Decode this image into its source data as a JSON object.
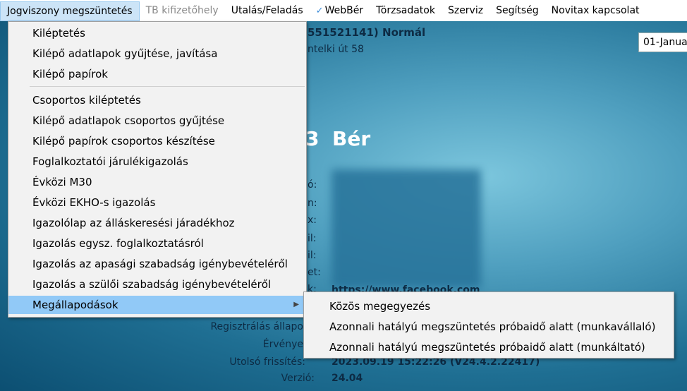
{
  "menubar": {
    "items": [
      {
        "label": "Jogviszony megszüntetés"
      },
      {
        "label": "TB kifizetőhely"
      },
      {
        "label": "Utalás/Feladás"
      },
      {
        "label": "WebBér"
      },
      {
        "label": "Törzsadatok"
      },
      {
        "label": "Szerviz"
      },
      {
        "label": "Segítség"
      },
      {
        "label": "Novitax kapcsolat"
      }
    ],
    "webber_check": "✓"
  },
  "dropdown": {
    "group1": [
      "Kiléptetés",
      "Kilépő adatlapok gyűjtése, javítása",
      "Kilépő papírok"
    ],
    "group2": [
      "Csoportos kiléptetés",
      "Kilépő adatlapok csoportos gyűjtése",
      "Kilépő papírok csoportos készítése",
      "Foglalkoztatói járulékigazolás",
      "Évközi M30",
      "Évközi EKHO-s igazolás",
      "Igazolólap az álláskeresési járadékhoz",
      "Igazolás egysz. foglalkoztatásról",
      "Igazolás az apasági szabadság igénybevételéről",
      "Igazolás a szülői szabadság igénybevételéről",
      "Megállapodások"
    ],
    "submenu_arrow": "▶"
  },
  "submenu": {
    "items": [
      "Közös megegyezés",
      "Azonnali hatályú megszüntetés próbaidő alatt (munkavállaló)",
      "Azonnali hatályú megszüntetés próbaidő alatt (munkáltató)"
    ]
  },
  "background": {
    "company_line": "551521141) Normál",
    "address_line": "ntelki út 58",
    "date": "01-Janua",
    "title_prefix": "3",
    "title": "Bér",
    "partial_labels": [
      "ó:",
      "n:",
      "x:",
      "il:",
      "il:",
      "et:",
      "k:"
    ],
    "facebook": "https://www.facebook.com",
    "reg_label": "Regisztrálás állapo",
    "valid_label": "Érvénye",
    "refresh_label": "Utolsó frissítés:",
    "refresh_value": "2023.09.19 15:22:26 (V24.4.2.22417)",
    "version_label": "Verzió:",
    "version_value": "24.04"
  }
}
